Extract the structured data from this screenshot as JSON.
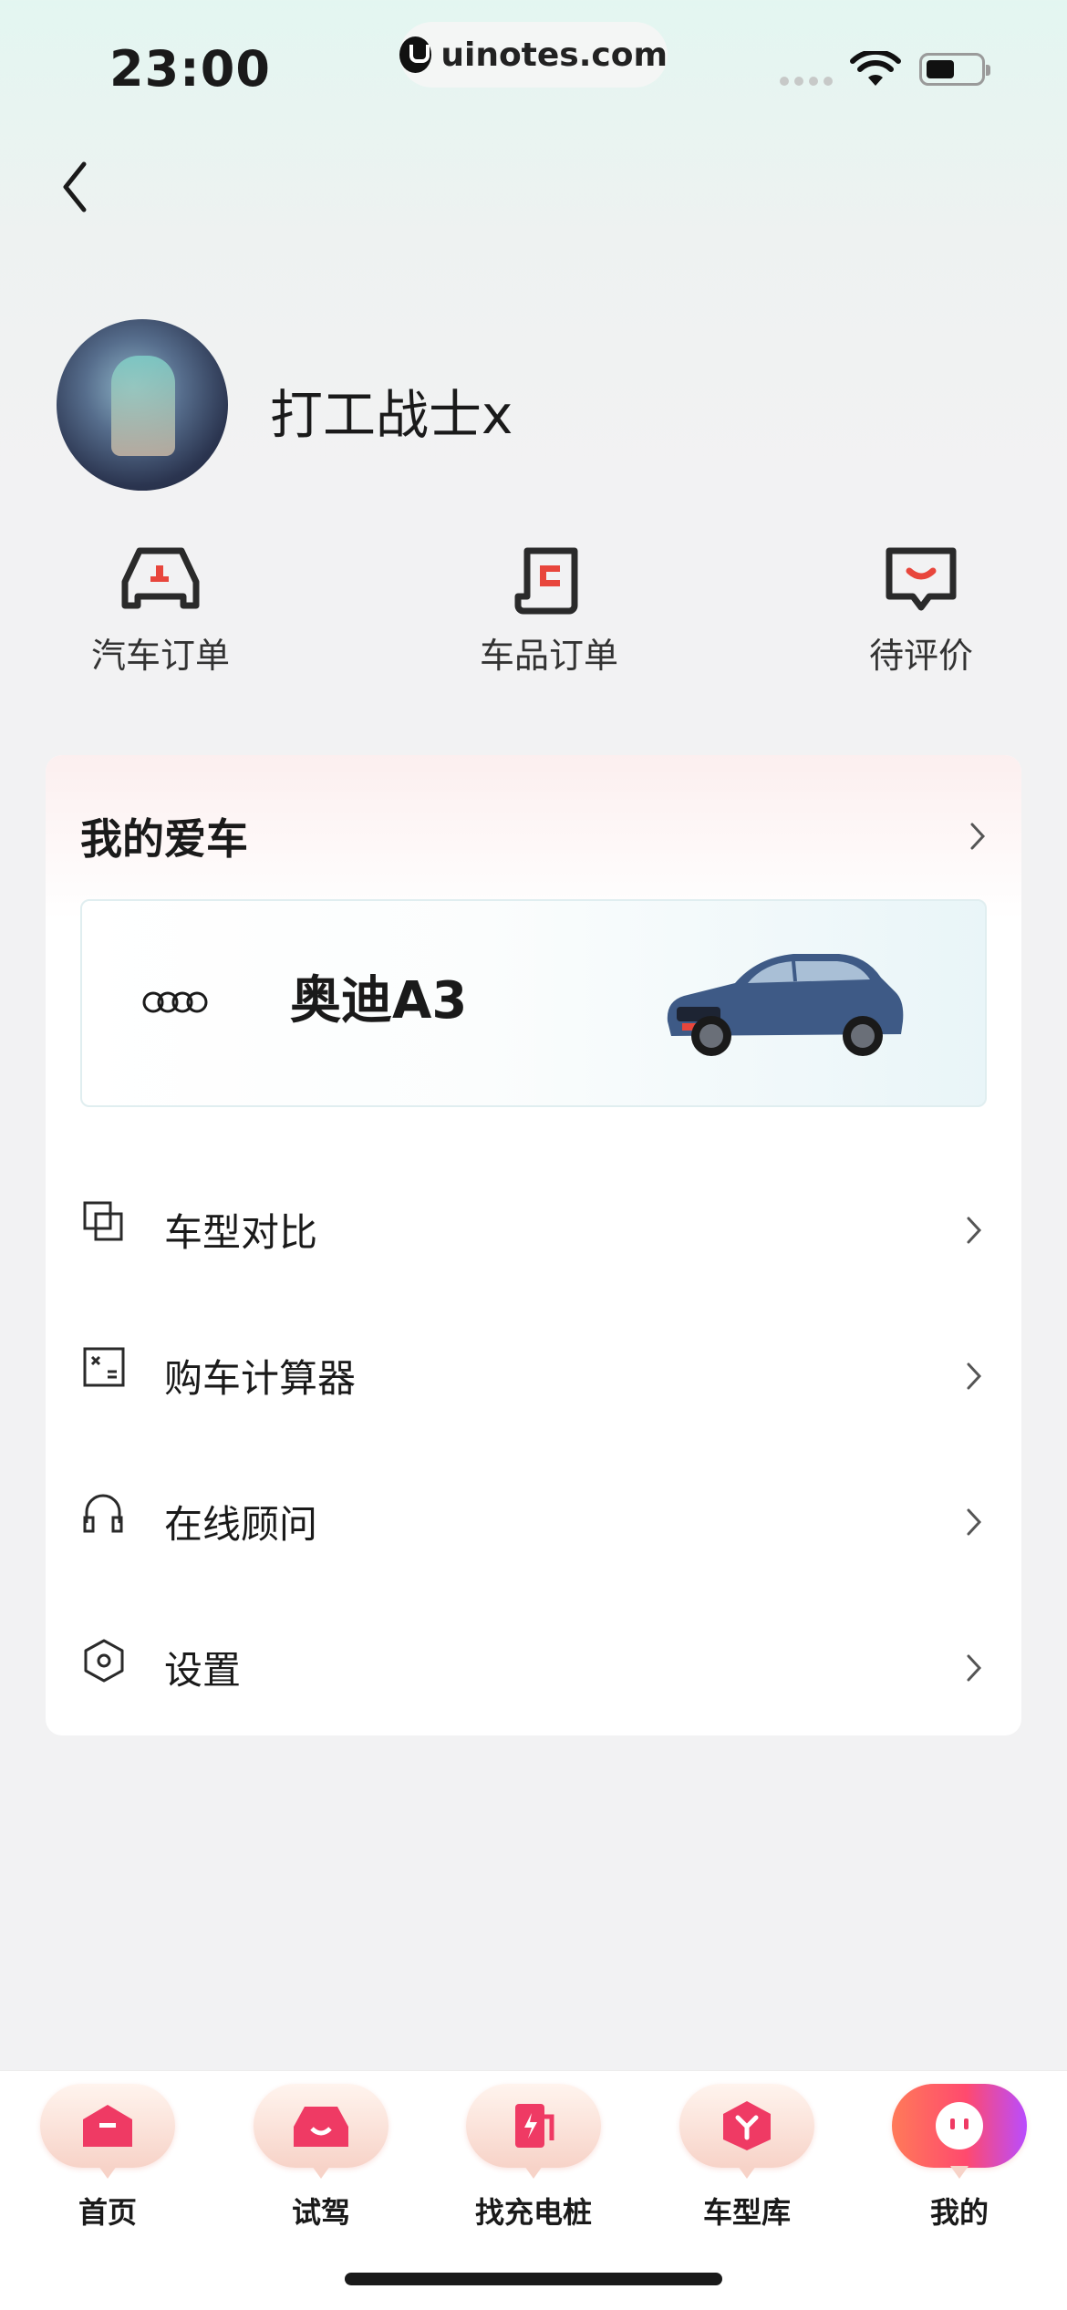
{
  "status_bar": {
    "time": "23:00",
    "url": "uinotes.com"
  },
  "profile": {
    "username": "打工战士x"
  },
  "quick_actions": [
    {
      "label": "汽车订单",
      "icon": "car-order-icon"
    },
    {
      "label": "车品订单",
      "icon": "product-order-icon"
    },
    {
      "label": "待评价",
      "icon": "review-icon"
    }
  ],
  "my_car": {
    "title": "我的爱车",
    "car_name": "奥迪A3",
    "brand_icon": "audi-rings-icon"
  },
  "menu": [
    {
      "label": "车型对比",
      "icon": "compare-icon"
    },
    {
      "label": "购车计算器",
      "icon": "calculator-icon"
    },
    {
      "label": "在线顾问",
      "icon": "headset-icon"
    },
    {
      "label": "设置",
      "icon": "settings-icon"
    }
  ],
  "tabs": [
    {
      "label": "首页",
      "icon": "home-icon"
    },
    {
      "label": "试驾",
      "icon": "test-drive-icon"
    },
    {
      "label": "找充电桩",
      "icon": "charging-icon"
    },
    {
      "label": "车型库",
      "icon": "car-library-icon"
    },
    {
      "label": "我的",
      "icon": "mine-icon",
      "active": true
    }
  ],
  "colors": {
    "accent": "#e8463c",
    "accent_gradient": [
      "#ff7a59",
      "#ff4a6e",
      "#b94cff"
    ],
    "icon_dark": "#2a2a2a"
  }
}
